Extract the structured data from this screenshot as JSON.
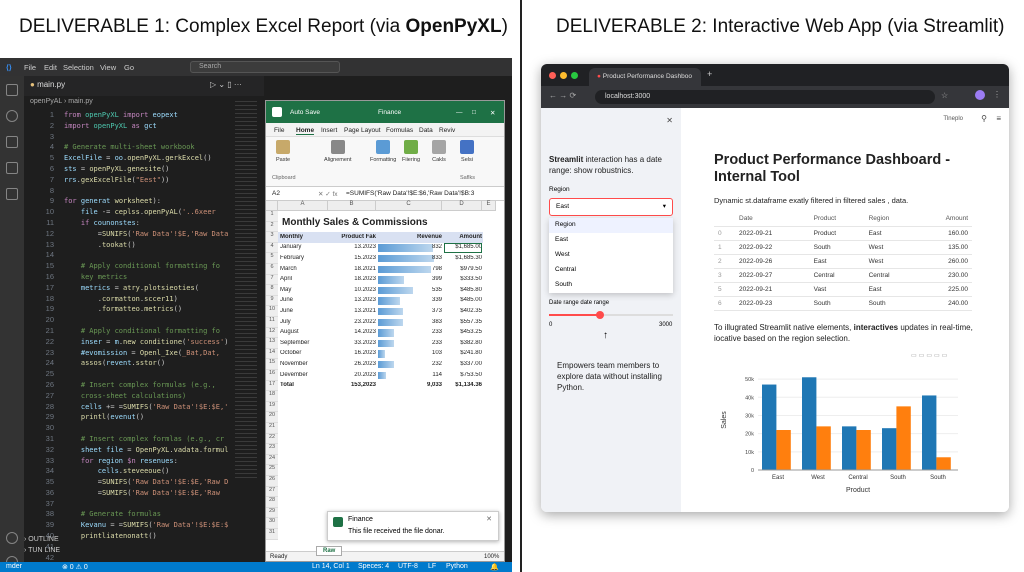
{
  "titles": {
    "d1_prefix": "DELIVERABLE 1: Complex Excel Report (via ",
    "d1_bold": "OpenPyXL",
    "d1_suffix": ")",
    "d2": "DELIVERABLE 2: Interactive Web App (via Streamlit)"
  },
  "vscode": {
    "menu": [
      "File",
      "Edit",
      "Selection",
      "View",
      "Go"
    ],
    "search_placeholder": "Search",
    "tab": "main.py",
    "breadcrumb": "openPyAL › main.py",
    "line_numbers": [
      "1",
      "2",
      "3",
      "4",
      "5",
      "6",
      "7",
      "8",
      "9",
      "10",
      "11",
      "12",
      "13",
      "14",
      "15",
      "16",
      "17",
      "18",
      "19",
      "20",
      "21",
      "22",
      "23",
      "24",
      "25",
      "26",
      "27",
      "28",
      "29",
      "30",
      "31",
      "32",
      "33",
      "34",
      "35",
      "36",
      "37",
      "38",
      "39",
      "40",
      "41",
      "42"
    ],
    "outline": "OUTLINE",
    "timeline": "TUN LINE",
    "status_left": "mder",
    "status_counts": "⊗ 0 ⚠ 0",
    "status_right": [
      "Ln 14, Col 1",
      "Speces: 4",
      "UTF-8",
      "LF",
      "Python"
    ]
  },
  "excel": {
    "autosave": "Auto Save",
    "file_name": "Finance",
    "menu": [
      "File",
      "Home",
      "Insert",
      "Page Layout",
      "Formulas",
      "Data",
      "Reviv"
    ],
    "ribbon": [
      "Paste",
      "Clipboard",
      "Alignement",
      "Formatting",
      "Fiiering",
      "Cakls",
      "Selsi",
      "Saflks"
    ],
    "name_box": "A2",
    "formula": "=SUMIFS('Raw Data'!$E:$6,'Raw Data'!$B:3",
    "columns": [
      "A",
      "B",
      "C",
      "D",
      "E"
    ],
    "sheet_title": "Monthly Sales & Commissions",
    "headers": [
      "Monthly",
      "Product Fak",
      "Revenue",
      "Amount"
    ],
    "rows": [
      [
        "January",
        "13.2023",
        "832",
        "$1,685.00"
      ],
      [
        "February",
        "15.2023",
        "833",
        "$1,685.30"
      ],
      [
        "March",
        "18.2021",
        "798",
        "$979.50"
      ],
      [
        "April",
        "18.2023",
        "399",
        "$333.50"
      ],
      [
        "May",
        "10.2023",
        "535",
        "$485.80"
      ],
      [
        "June",
        "13.2023",
        "339",
        "$485.00"
      ],
      [
        "June",
        "13.2021",
        "373",
        "$402.35"
      ],
      [
        "July",
        "23.2022",
        "383",
        "$557.35"
      ],
      [
        "August",
        "14.2023",
        "233",
        "$453.25"
      ],
      [
        "September",
        "33.2023",
        "233",
        "$382.80"
      ],
      [
        "October",
        "16.2023",
        "103",
        "$241.80"
      ],
      [
        "November",
        "26.2023",
        "232",
        "$337.00"
      ],
      [
        "Devember",
        "20.2023",
        "114",
        "$753.50"
      ]
    ],
    "revenue_bar_fill": [
      0.92,
      0.93,
      0.88,
      0.44,
      0.59,
      0.37,
      0.41,
      0.42,
      0.26,
      0.26,
      0.11,
      0.26,
      0.13
    ],
    "total": [
      "Total",
      "153,2023",
      "9,033",
      "$1,134.36"
    ],
    "row_numbers": [
      "1",
      "2",
      "3",
      "4",
      "5",
      "6",
      "7",
      "8",
      "9",
      "10",
      "11",
      "12",
      "13",
      "14",
      "15",
      "16",
      "17",
      "18",
      "19",
      "20",
      "21",
      "22",
      "23",
      "24",
      "25",
      "26",
      "27",
      "28",
      "29",
      "30",
      "31"
    ],
    "status": "Ready",
    "sheet_tab": "Raw",
    "zoom": "100%"
  },
  "toast": {
    "title": "Finance",
    "message": "This file received the file donar."
  },
  "browser": {
    "tab_title": "Product Performance Dashboo",
    "url": "localhost:3000",
    "side_text_bold": "Streamlit",
    "side_text": " interaction has a date range: show robustnics.",
    "region_label": "Region",
    "region_value": "East",
    "options": [
      "Region",
      "East",
      "West",
      "Central",
      "South"
    ],
    "date_label": "Date range date range",
    "slider_min": "0",
    "slider_max": "3000",
    "slider_fraction": 0.41,
    "annotation": "Empowers team members to explore data without installing Python.",
    "menu_label": "Tlneplo",
    "main_title": "Product Performance Dashboard - Internal Tool",
    "subtitle": "Dynamic st.dataframe exatly filtered in filtered sales , data.",
    "table_headers": [
      "",
      "Date",
      "Product",
      "Region",
      "Amount"
    ],
    "table_rows": [
      [
        "0",
        "2022-09-21",
        "Product",
        "East",
        "160.00"
      ],
      [
        "1",
        "2022-09-22",
        "South",
        "West",
        "135.00"
      ],
      [
        "2",
        "2022-09-26",
        "East",
        "West",
        "260.00"
      ],
      [
        "3",
        "2022-09-27",
        "Central",
        "Central",
        "230.00"
      ],
      [
        "5",
        "2022-09-21",
        "Vast",
        "East",
        "225.00"
      ],
      [
        "6",
        "2022-09-23",
        "South",
        "South",
        "240.00"
      ]
    ],
    "para_prefix": "To illugrated Streamlit native elements, ",
    "para_bold": "interactives",
    "para_suffix": " updates in real-time, iocative based on the region selection."
  },
  "chart_data": {
    "type": "bar",
    "categories": [
      "East",
      "West",
      "Central",
      "South",
      "South"
    ],
    "series": [
      {
        "values": [
          47,
          51,
          24,
          23,
          41
        ],
        "color": "#1f77b4"
      },
      {
        "values": [
          22,
          24,
          22,
          35,
          7
        ],
        "color": "#ff7f0e"
      }
    ],
    "xlabel": "Product",
    "ylabel": "Sales",
    "yticks": [
      "0",
      "10k",
      "20k",
      "30k",
      "40k",
      "50k"
    ],
    "ylim": [
      0,
      55
    ]
  }
}
